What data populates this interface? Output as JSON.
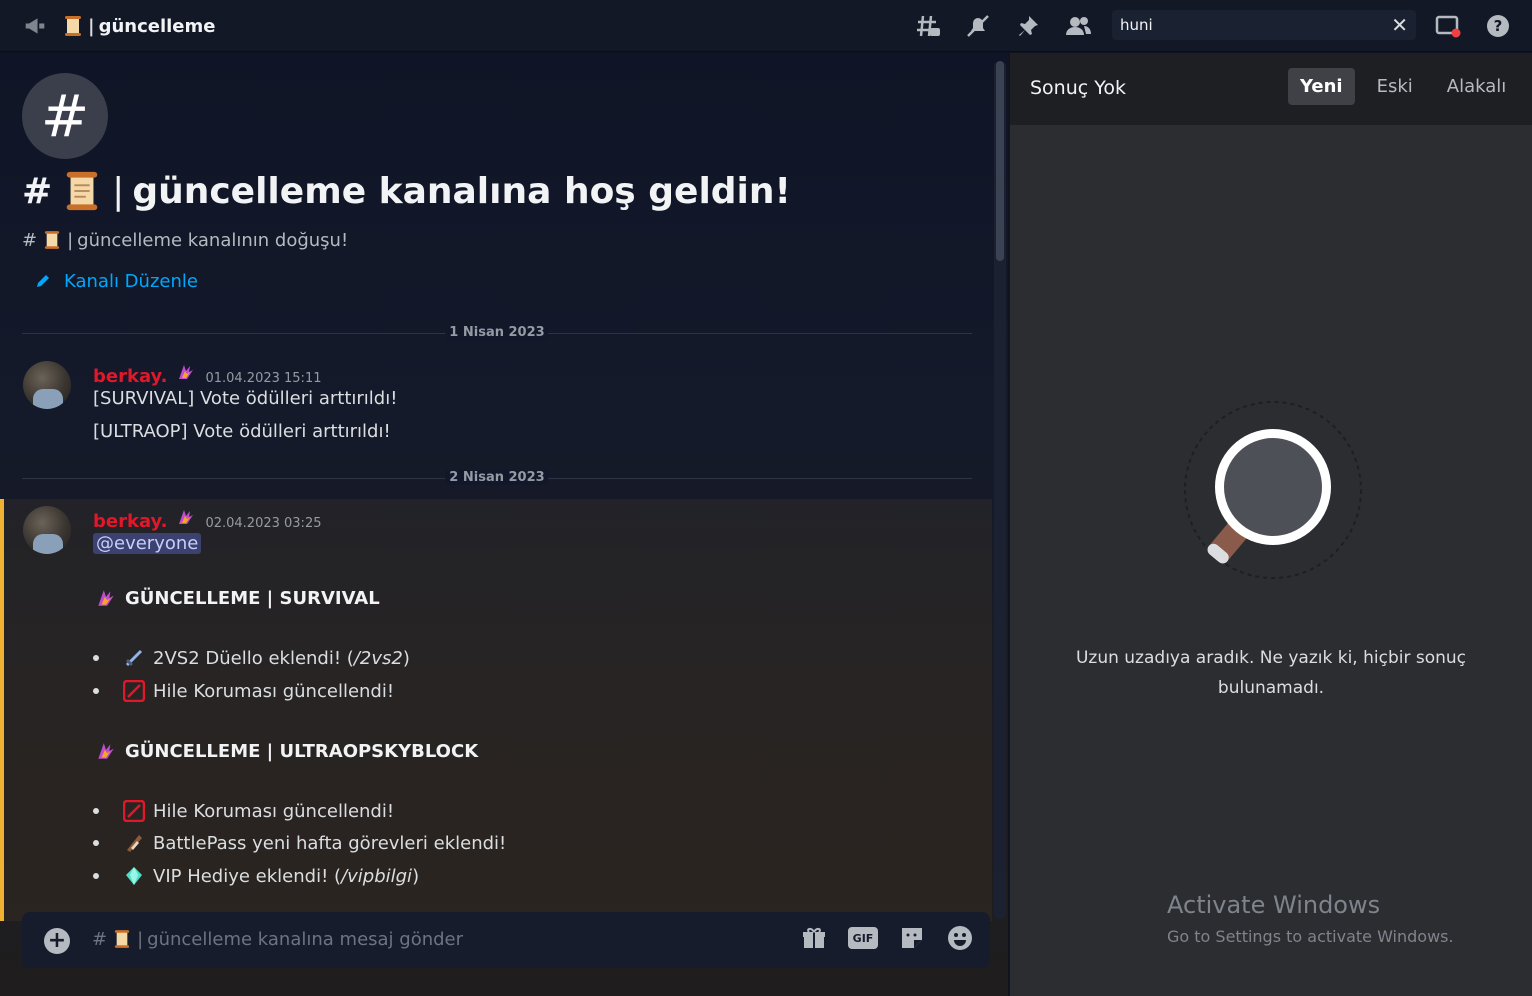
{
  "header": {
    "channel_name": "güncelleme",
    "search_value": "huni",
    "icons": [
      "threads-icon",
      "mute-icon",
      "pin-icon",
      "members-icon",
      "inbox-icon",
      "help-icon"
    ]
  },
  "channel": {
    "welcome_title": "güncelleme kanalına hoş geldin!",
    "topic": "güncelleme kanalının doğuşu!",
    "edit_label": "Kanalı Düzenle"
  },
  "dividers": [
    "1 Nisan 2023",
    "2 Nisan 2023"
  ],
  "messages": [
    {
      "author": "berkay.",
      "timestamp": "01.04.2023 15:11",
      "lines": [
        "[SURVIVAL] Vote ödülleri arttırıldı!",
        "[ULTRAOP] Vote ödülleri arttırıldı!"
      ]
    },
    {
      "author": "berkay.",
      "timestamp": "02.04.2023 03:25",
      "mention": "@everyone",
      "sections": [
        {
          "title": "GÜNCELLEME | SURVIVAL",
          "items": [
            {
              "text": "2VS2 Düello eklendi! (",
              "cmd": "/2vs2",
              "close": ")",
              "icon": "sword-icon"
            },
            {
              "text": "Hile Koruması güncellendi!",
              "icon": "no-entry-icon"
            }
          ]
        },
        {
          "title": "GÜNCELLEME | ULTRAOPSKYBLOCK",
          "items": [
            {
              "text": "Hile Koruması güncellendi!",
              "icon": "no-entry-icon"
            },
            {
              "text": "BattlePass yeni hafta görevleri eklendi!",
              "icon": "scroll-icon"
            },
            {
              "text": "VIP Hediye eklendi! (",
              "cmd": "/vipbilgi",
              "close": ")",
              "icon": "diamond-icon"
            }
          ]
        }
      ]
    }
  ],
  "composer": {
    "placeholder": "güncelleme kanalına mesaj gönder",
    "gif_label": "GIF"
  },
  "search_panel": {
    "title": "Sonuç Yok",
    "tabs": [
      "Yeni",
      "Eski",
      "Alakalı"
    ],
    "active_tab": "Yeni",
    "empty_message": "Uzun uzadıya aradık. Ne yazık ki, hiçbir sonuç bulunamadı."
  },
  "watermark": {
    "title": "Activate Windows",
    "subtitle": "Go to Settings to activate Windows."
  },
  "colors": {
    "author": "#e0182a",
    "link": "#00a8fc",
    "highlight_border": "#f0b232"
  }
}
